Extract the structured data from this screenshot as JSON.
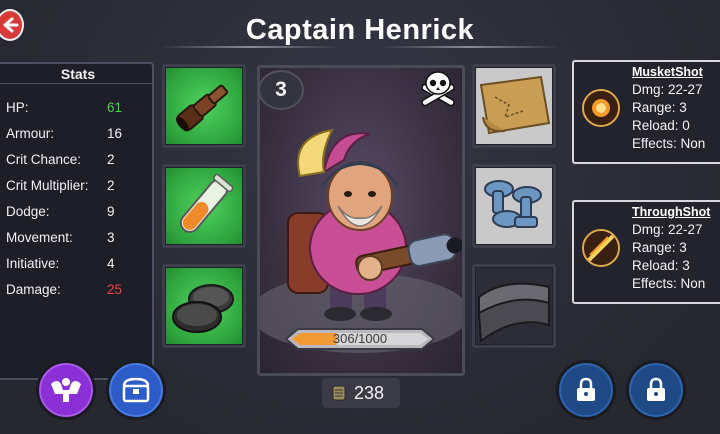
{
  "title": "Captain Henrick",
  "stats": {
    "header": "Stats",
    "rows": [
      {
        "label": "HP:",
        "value": "61",
        "color": "#4fd14f"
      },
      {
        "label": "Armour:",
        "value": "16",
        "color": "#f2f2f2"
      },
      {
        "label": "Crit Chance:",
        "value": "2",
        "color": "#f2f2f2"
      },
      {
        "label": "Crit Multiplier:",
        "value": "2",
        "color": "#f2f2f2"
      },
      {
        "label": "Dodge:",
        "value": "9",
        "color": "#f2f2f2"
      },
      {
        "label": "Movement:",
        "value": "3",
        "color": "#f2f2f2"
      },
      {
        "label": "Initiative:",
        "value": "4",
        "color": "#f2f2f2"
      },
      {
        "label": "Damage:",
        "value": "25",
        "color": "#e84646"
      }
    ]
  },
  "hero": {
    "level": "3",
    "class_icon": "skull-crossbones-icon",
    "xp_text": "306/1000",
    "xp_fraction": 0.306
  },
  "gold": {
    "value": "238",
    "icon": "coin-stack-icon"
  },
  "left_slots": [
    {
      "icon": "spyglass-icon",
      "bg": "green"
    },
    {
      "icon": "potion-vial-icon",
      "bg": "green"
    },
    {
      "icon": "bombs-icon",
      "bg": "green"
    }
  ],
  "right_slots": [
    {
      "icon": "map-scroll-icon",
      "bg": "gray"
    },
    {
      "icon": "bolts-icon",
      "bg": "gray"
    },
    {
      "icon": "cloth-icon",
      "bg": "dark"
    }
  ],
  "skills": [
    {
      "name": "MusketShot",
      "dmg": "Dmg:  22-27",
      "range": "Range:  3",
      "reload": "Reload:  0",
      "effects": "Effects:  Non"
    },
    {
      "name": "ThroughShot",
      "dmg": "Dmg:  22-27",
      "range": "Range:  3",
      "reload": "Reload:  3",
      "effects": "Effects:  Non"
    }
  ],
  "buttons": {
    "strength": "strength-icon",
    "inventory": "chest-icon",
    "lock1": "lock-icon",
    "lock2": "lock-icon"
  }
}
